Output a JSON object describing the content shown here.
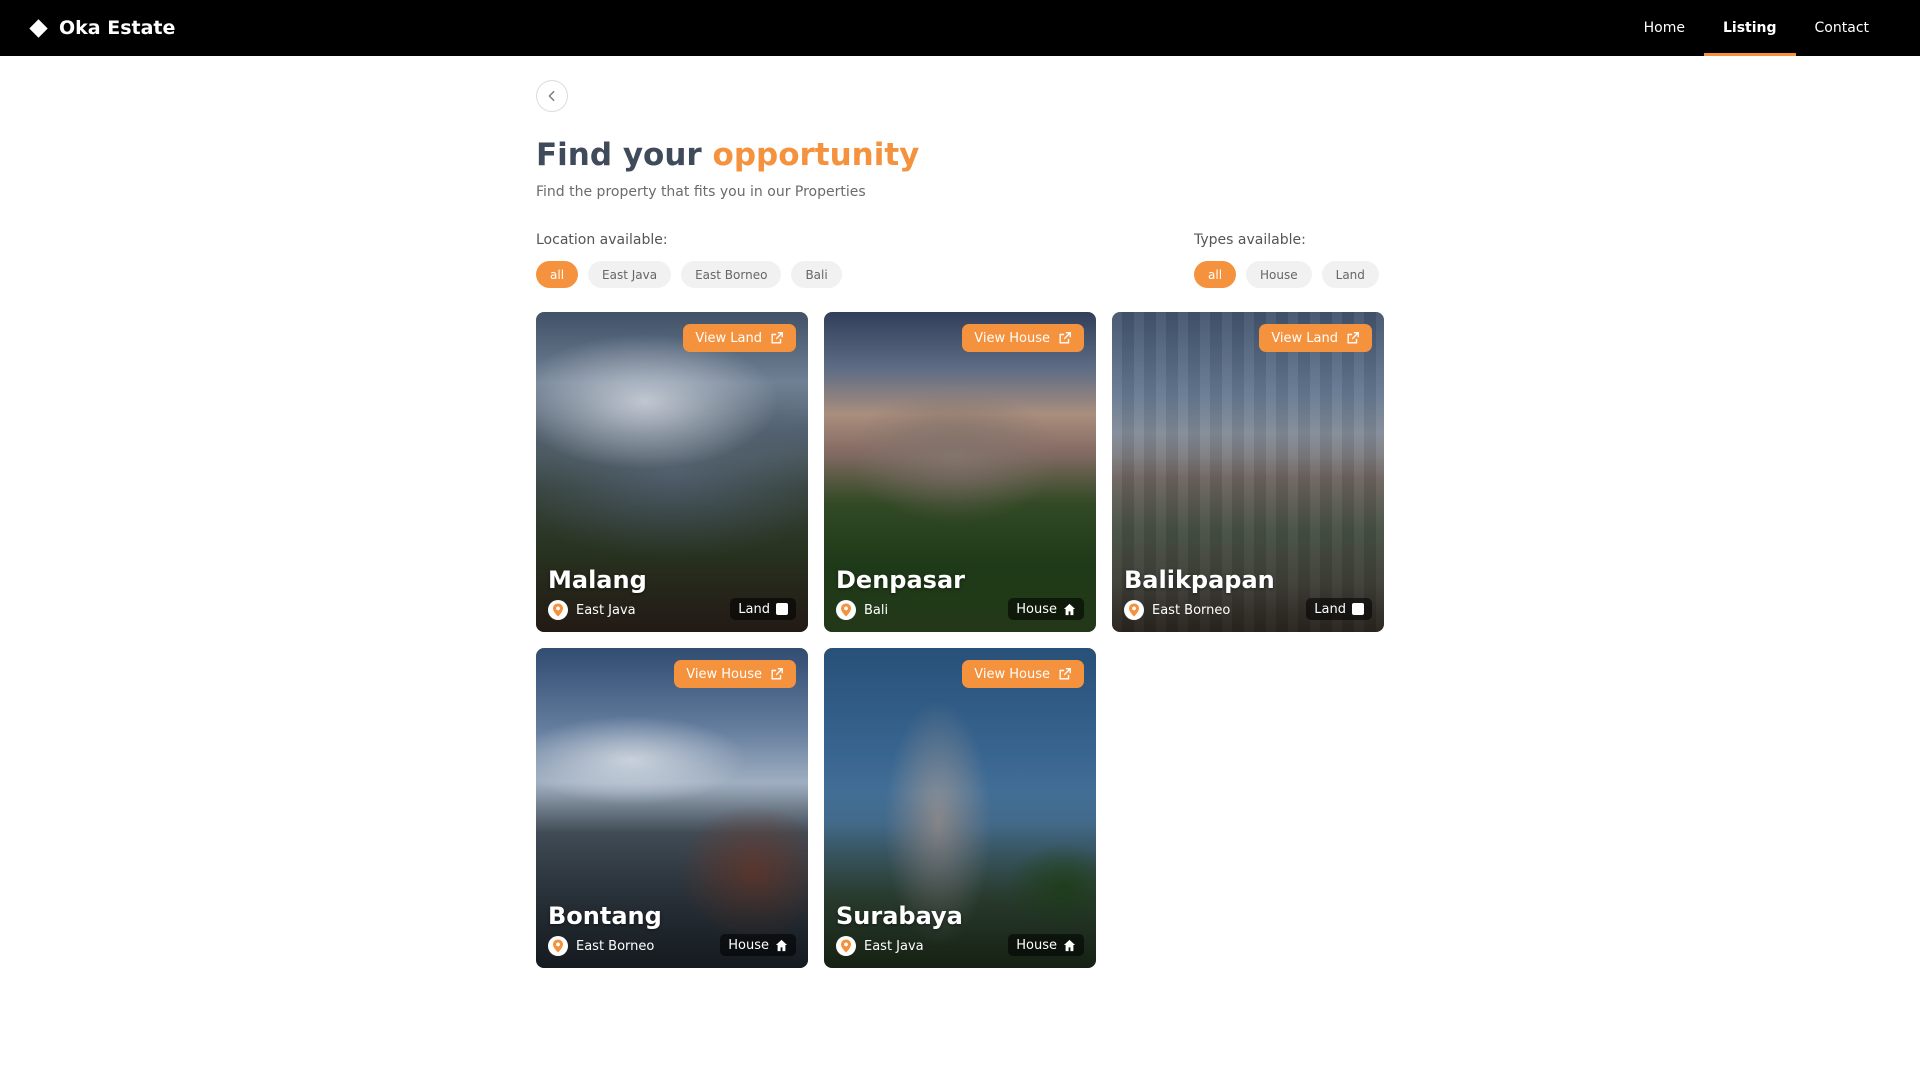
{
  "brand": {
    "name": "Oka Estate"
  },
  "nav": {
    "items": [
      {
        "label": "Home",
        "active": false
      },
      {
        "label": "Listing",
        "active": true
      },
      {
        "label": "Contact",
        "active": false
      }
    ]
  },
  "page": {
    "title_prefix": "Find your",
    "title_accent": "opportunity",
    "subtitle": "Find the property that fits you in our Properties"
  },
  "filters": {
    "location": {
      "label": "Location available:",
      "options": [
        {
          "label": "all",
          "active": true
        },
        {
          "label": "East Java",
          "active": false
        },
        {
          "label": "East Borneo",
          "active": false
        },
        {
          "label": "Bali",
          "active": false
        }
      ]
    },
    "types": {
      "label": "Types available:",
      "options": [
        {
          "label": "all",
          "active": true
        },
        {
          "label": "House",
          "active": false
        },
        {
          "label": "Land",
          "active": false
        }
      ]
    }
  },
  "colors": {
    "accent": "#f5923e",
    "nav_bg": "#000000"
  },
  "listings": [
    {
      "name": "Malang",
      "location": "East Java",
      "type": "Land",
      "type_icon": "square-icon",
      "action": "View Land"
    },
    {
      "name": "Denpasar",
      "location": "Bali",
      "type": "House",
      "type_icon": "house-icon",
      "action": "View House"
    },
    {
      "name": "Balikpapan",
      "location": "East Borneo",
      "type": "Land",
      "type_icon": "square-icon",
      "action": "View Land"
    },
    {
      "name": "Bontang",
      "location": "East Borneo",
      "type": "House",
      "type_icon": "house-icon",
      "action": "View House"
    },
    {
      "name": "Surabaya",
      "location": "East Java",
      "type": "House",
      "type_icon": "house-icon",
      "action": "View House"
    }
  ]
}
